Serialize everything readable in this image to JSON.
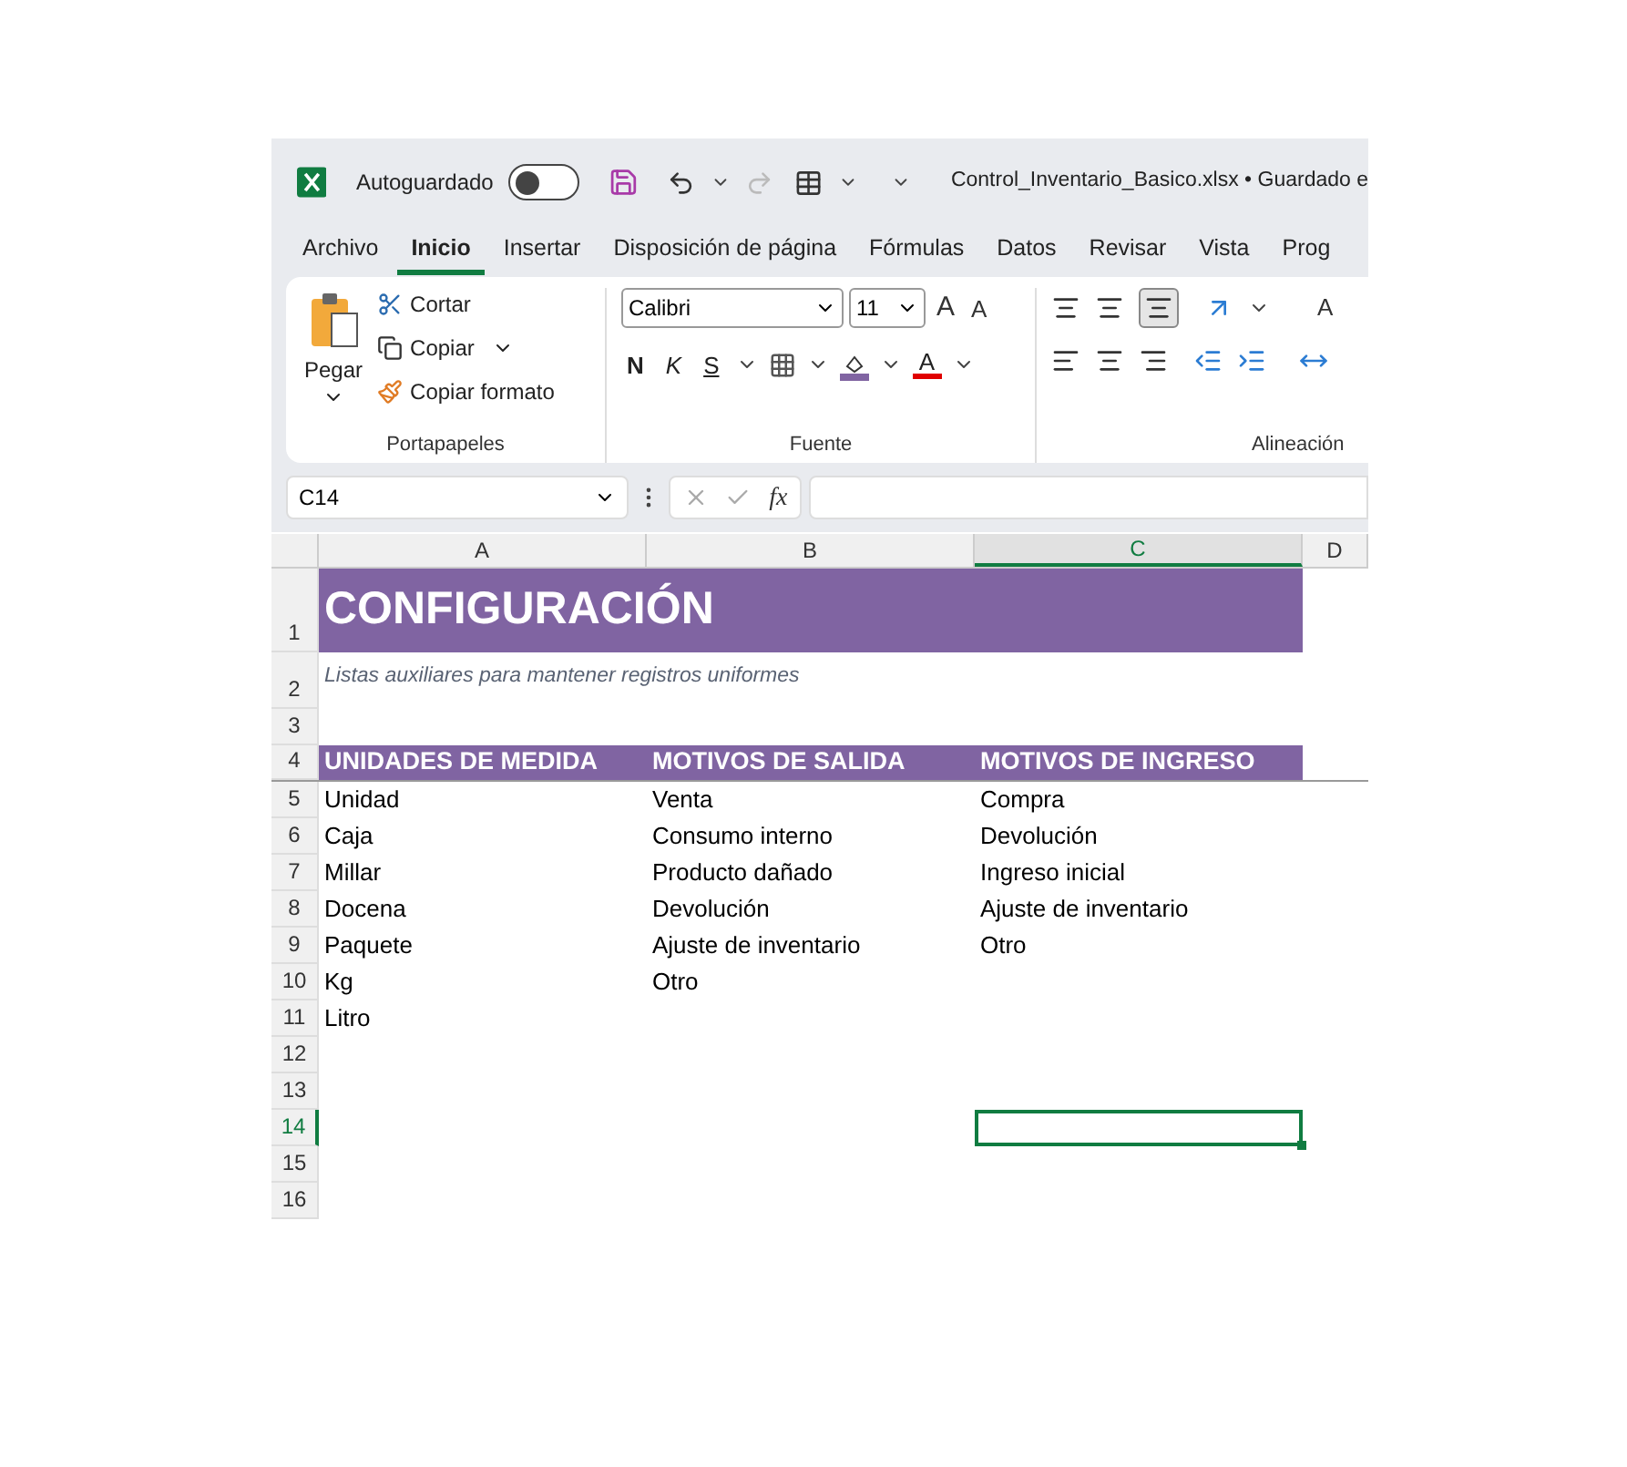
{
  "title_bar": {
    "autosave_label": "Autoguardado",
    "autosave_on": false,
    "file_title": "Control_Inventario_Basico.xlsx • Guardado e"
  },
  "menu_tabs": [
    {
      "label": "Archivo",
      "selected": false
    },
    {
      "label": "Inicio",
      "selected": true
    },
    {
      "label": "Insertar",
      "selected": false
    },
    {
      "label": "Disposición de página",
      "selected": false
    },
    {
      "label": "Fórmulas",
      "selected": false
    },
    {
      "label": "Datos",
      "selected": false
    },
    {
      "label": "Revisar",
      "selected": false
    },
    {
      "label": "Vista",
      "selected": false
    },
    {
      "label": "Prog",
      "selected": false
    }
  ],
  "ribbon": {
    "clipboard": {
      "paste": "Pegar",
      "cut": "Cortar",
      "copy": "Copiar",
      "format_painter": "Copiar formato",
      "label": "Portapapeles"
    },
    "font": {
      "family": "Calibri",
      "size": "11",
      "grow": "A",
      "shrink": "A",
      "bold": "N",
      "italic": "K",
      "underline": "S",
      "font_color": "A",
      "label": "Fuente"
    },
    "alignment": {
      "wrap": "A",
      "label": "Alineación"
    }
  },
  "formula_bar": {
    "name_box": "C14",
    "function_button": "fx"
  },
  "columns": [
    {
      "label": "A",
      "selected": false
    },
    {
      "label": "B",
      "selected": false
    },
    {
      "label": "C",
      "selected": true
    },
    {
      "label": "D",
      "selected": false
    }
  ],
  "rows": [
    {
      "number": "1",
      "kind": "title",
      "selected": false,
      "cells": [
        "CONFIGURACIÓN"
      ]
    },
    {
      "number": "2",
      "kind": "subtitle",
      "selected": false,
      "cells": [
        "Listas auxiliares para mantener registros uniformes"
      ]
    },
    {
      "number": "3",
      "kind": "data",
      "selected": false,
      "cells": []
    },
    {
      "number": "4",
      "kind": "header",
      "selected": false,
      "cells": [
        "UNIDADES DE MEDIDA",
        "MOTIVOS DE SALIDA",
        "MOTIVOS DE INGRESO"
      ]
    },
    {
      "number": "5",
      "kind": "data",
      "selected": false,
      "cells": [
        "Unidad",
        "Venta",
        "Compra"
      ]
    },
    {
      "number": "6",
      "kind": "data",
      "selected": false,
      "cells": [
        "Caja",
        "Consumo interno",
        "Devolución"
      ]
    },
    {
      "number": "7",
      "kind": "data",
      "selected": false,
      "cells": [
        "Millar",
        "Producto dañado",
        "Ingreso inicial"
      ]
    },
    {
      "number": "8",
      "kind": "data",
      "selected": false,
      "cells": [
        "Docena",
        "Devolución",
        "Ajuste de inventario"
      ]
    },
    {
      "number": "9",
      "kind": "data",
      "selected": false,
      "cells": [
        "Paquete",
        "Ajuste de inventario",
        "Otro"
      ]
    },
    {
      "number": "10",
      "kind": "data",
      "selected": false,
      "cells": [
        "Kg",
        "Otro"
      ]
    },
    {
      "number": "11",
      "kind": "data",
      "selected": false,
      "cells": [
        "Litro"
      ]
    },
    {
      "number": "12",
      "kind": "data",
      "selected": false,
      "cells": []
    },
    {
      "number": "13",
      "kind": "data",
      "selected": false,
      "cells": []
    },
    {
      "number": "14",
      "kind": "data",
      "selected": true,
      "cells": []
    },
    {
      "number": "15",
      "kind": "data",
      "selected": false,
      "cells": []
    },
    {
      "number": "16",
      "kind": "data",
      "selected": false,
      "cells": []
    }
  ]
}
